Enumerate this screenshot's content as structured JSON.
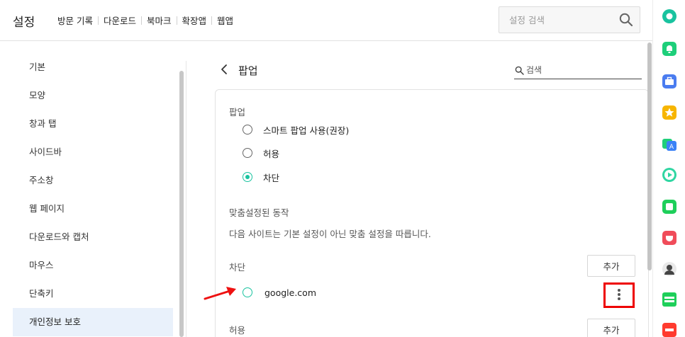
{
  "header": {
    "title": "설정",
    "nav": [
      "방문 기록",
      "다운로드",
      "북마크",
      "확장앱",
      "웹앱"
    ],
    "search_placeholder": "설정 검색"
  },
  "sidebar": {
    "items": [
      {
        "label": "기본"
      },
      {
        "label": "모양"
      },
      {
        "label": "창과 탭"
      },
      {
        "label": "사이드바"
      },
      {
        "label": "주소창"
      },
      {
        "label": "웹 페이지"
      },
      {
        "label": "다운로드와 캡처"
      },
      {
        "label": "마우스"
      },
      {
        "label": "단축키"
      },
      {
        "label": "개인정보 보호",
        "active": true
      }
    ]
  },
  "main": {
    "title": "팝업",
    "search_placeholder": "검색",
    "section_label": "팝업",
    "options": [
      {
        "label": "스마트 팝업 사용(권장)",
        "checked": false
      },
      {
        "label": "허용",
        "checked": false
      },
      {
        "label": "차단",
        "checked": true
      }
    ],
    "custom_title": "맞춤설정된 동작",
    "custom_desc": "다음 사이트는 기본 설정이 아닌 맞춤 설정을 따릅니다.",
    "block_label": "차단",
    "allow_label": "허용",
    "add_label": "추가",
    "blocked_sites": [
      "google.com"
    ]
  },
  "colors": {
    "accent": "#19c39f",
    "highlight": "#ee0000",
    "sidebar_active_bg": "#e9f1fb"
  },
  "rightbar_icons": [
    "whale-icon",
    "bell-icon",
    "briefcase-icon",
    "star-icon",
    "translate-icon",
    "play-icon",
    "square-app-icon",
    "pocket-icon",
    "avatar-icon",
    "webtoon-icon",
    "news-icon"
  ]
}
